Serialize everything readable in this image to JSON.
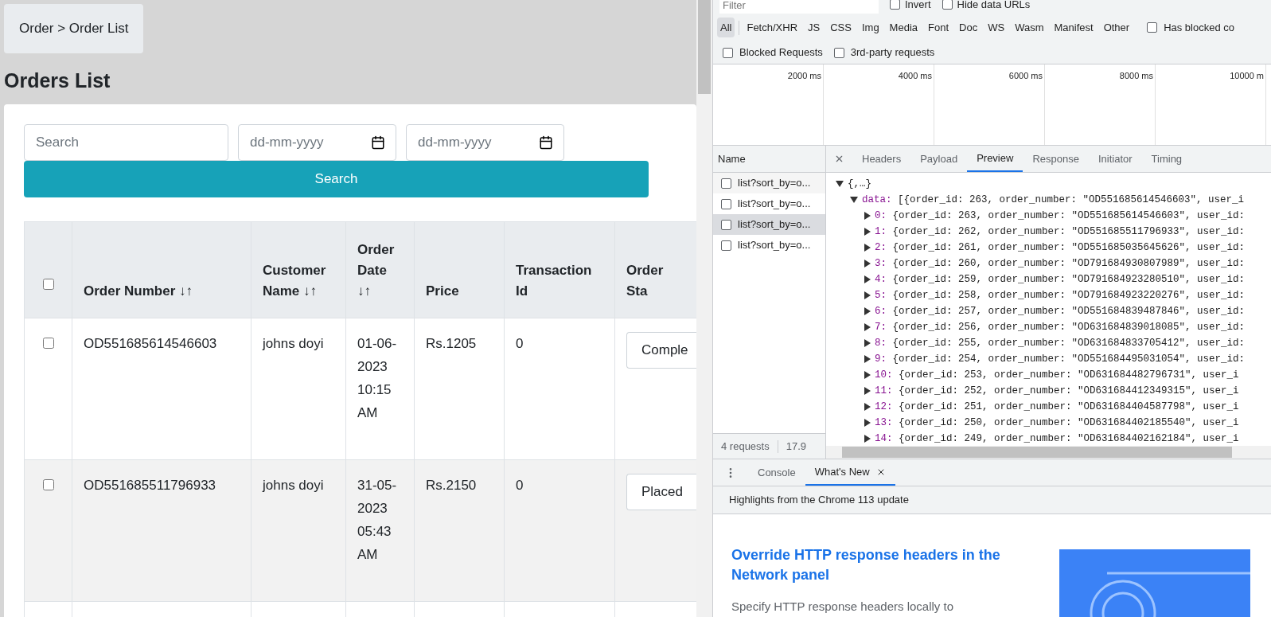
{
  "breadcrumb": "Order > Order List",
  "page_title": "Orders List",
  "filters": {
    "search": {
      "placeholder": "Search"
    },
    "date_from": {
      "placeholder": "dd-mm-yyyy"
    },
    "date_to": {
      "placeholder": "dd-mm-yyyy"
    },
    "button": "Search"
  },
  "table": {
    "select_all_checked": false,
    "columns": [
      {
        "label": "Order Number ↓↑"
      },
      {
        "label": "Customer Name ↓↑"
      },
      {
        "label": "Order Date ↓↑"
      },
      {
        "label": "Price"
      },
      {
        "label": "Transaction Id"
      },
      {
        "label": "Order Sta"
      }
    ],
    "rows": [
      {
        "checked": false,
        "order_number": "OD551685614546603",
        "customer": "johns doyi",
        "date": "01-06-2023 10:15 AM",
        "price": "Rs.1205",
        "transaction_id": "0",
        "status": "Comple"
      },
      {
        "checked": false,
        "order_number": "OD551685511796933",
        "customer": "johns doyi",
        "date": "31-05-2023 05:43 AM",
        "price": "Rs.2150",
        "transaction_id": "0",
        "status": "Placed"
      }
    ]
  },
  "devtools": {
    "filter": {
      "placeholder": "Filter"
    },
    "options": [
      {
        "label": "Invert",
        "checked": false
      },
      {
        "label": "Hide data URLs",
        "checked": false
      }
    ],
    "type_filters": [
      {
        "label": "All",
        "selected": true
      },
      {
        "label": "Fetch/XHR",
        "selected": false
      },
      {
        "label": "JS",
        "selected": false
      },
      {
        "label": "CSS",
        "selected": false
      },
      {
        "label": "Img",
        "selected": false
      },
      {
        "label": "Media",
        "selected": false
      },
      {
        "label": "Font",
        "selected": false
      },
      {
        "label": "Doc",
        "selected": false
      },
      {
        "label": "WS",
        "selected": false
      },
      {
        "label": "Wasm",
        "selected": false
      },
      {
        "label": "Manifest",
        "selected": false
      },
      {
        "label": "Other",
        "selected": false
      }
    ],
    "has_blocked": {
      "label": "Has blocked co",
      "checked": false
    },
    "options2": [
      {
        "label": "Blocked Requests",
        "checked": false
      },
      {
        "label": "3rd-party requests",
        "checked": false
      }
    ],
    "timeline_ticks": [
      "2000 ms",
      "4000 ms",
      "6000 ms",
      "8000 ms",
      "10000 m"
    ],
    "name_header": "Name",
    "requests": [
      {
        "name": "list?sort_by=o...",
        "selected": false
      },
      {
        "name": "list?sort_by=o...",
        "selected": false
      },
      {
        "name": "list?sort_by=o...",
        "selected": true
      },
      {
        "name": "list?sort_by=o...",
        "selected": false
      }
    ],
    "summary": [
      "4 requests",
      "17.9"
    ],
    "detail_tabs": [
      {
        "label": "Headers",
        "selected": false
      },
      {
        "label": "Payload",
        "selected": false
      },
      {
        "label": "Preview",
        "selected": true
      },
      {
        "label": "Response",
        "selected": false
      },
      {
        "label": "Initiator",
        "selected": false
      },
      {
        "label": "Timing",
        "selected": false
      }
    ],
    "preview": {
      "value": "{,…}",
      "expanded": true,
      "children": [
        {
          "key": "data:",
          "value": "[{order_id: 263, order_number: \"OD551685614546603\", user_i",
          "expanded": true,
          "children": [
            {
              "key": "0:",
              "value": "{order_id: 263, order_number: \"OD551685614546603\", user_id:",
              "expanded": false
            },
            {
              "key": "1:",
              "value": "{order_id: 262, order_number: \"OD551685511796933\", user_id:",
              "expanded": false
            },
            {
              "key": "2:",
              "value": "{order_id: 261, order_number: \"OD551685035645626\", user_id:",
              "expanded": false
            },
            {
              "key": "3:",
              "value": "{order_id: 260, order_number: \"OD791684930807989\", user_id:",
              "expanded": false
            },
            {
              "key": "4:",
              "value": "{order_id: 259, order_number: \"OD791684923280510\", user_id:",
              "expanded": false
            },
            {
              "key": "5:",
              "value": "{order_id: 258, order_number: \"OD791684923220276\", user_id:",
              "expanded": false
            },
            {
              "key": "6:",
              "value": "{order_id: 257, order_number: \"OD551684839487846\", user_id:",
              "expanded": false
            },
            {
              "key": "7:",
              "value": "{order_id: 256, order_number: \"OD631684839018085\", user_id:",
              "expanded": false
            },
            {
              "key": "8:",
              "value": "{order_id: 255, order_number: \"OD631684833705412\", user_id:",
              "expanded": false
            },
            {
              "key": "9:",
              "value": "{order_id: 254, order_number: \"OD551684495031054\", user_id:",
              "expanded": false
            },
            {
              "key": "10:",
              "value": "{order_id: 253, order_number: \"OD631684482796731\", user_i",
              "expanded": false
            },
            {
              "key": "11:",
              "value": "{order_id: 252, order_number: \"OD631684412349315\", user_i",
              "expanded": false
            },
            {
              "key": "12:",
              "value": "{order_id: 251, order_number: \"OD631684404587798\", user_i",
              "expanded": false
            },
            {
              "key": "13:",
              "value": "{order_id: 250, order_number: \"OD631684402185540\", user_i",
              "expanded": false
            },
            {
              "key": "14:",
              "value": "{order_id: 249, order_number: \"OD631684402162184\", user_i",
              "expanded": false
            }
          ]
        }
      ]
    },
    "drawer_tabs": [
      {
        "label": "Console",
        "selected": false,
        "closable": false
      },
      {
        "label": "What's New",
        "selected": true,
        "closable": true
      }
    ],
    "highlights": "Highlights from the Chrome 113 update",
    "article": {
      "title": "Override HTTP response headers in the Network panel",
      "body": "Specify HTTP response headers locally to"
    }
  }
}
